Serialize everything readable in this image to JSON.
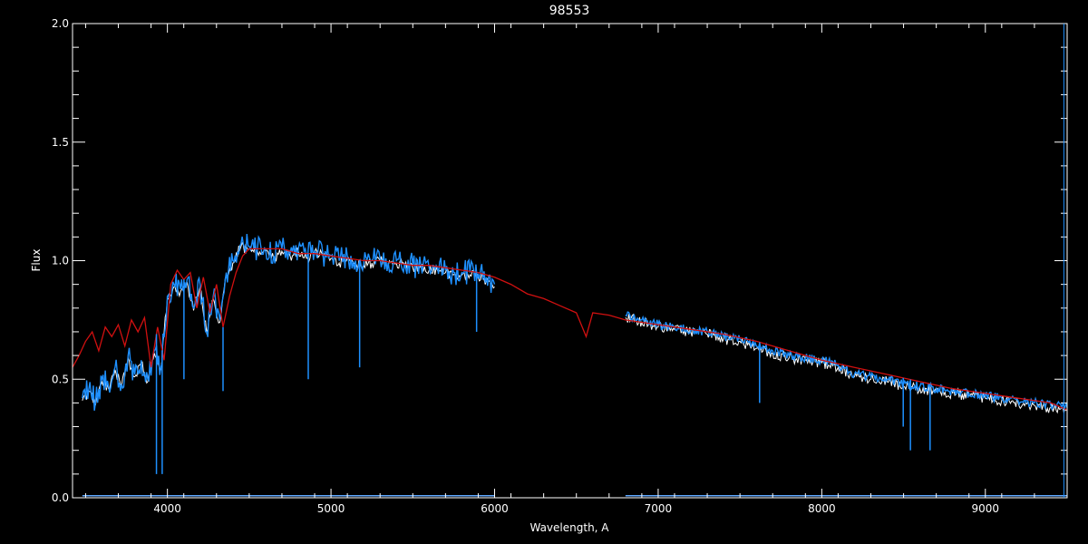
{
  "chart_data": {
    "type": "line",
    "title": "98553",
    "xlabel": "Wavelength, A",
    "ylabel": "Flux",
    "xlim": [
      3420,
      9500
    ],
    "ylim": [
      0.0,
      2.0
    ],
    "x_ticks": [
      4000,
      5000,
      6000,
      7000,
      8000,
      9000
    ],
    "x_tick_labels": [
      "4000",
      "5000",
      "6000",
      "7000",
      "8000",
      "9000"
    ],
    "y_ticks": [
      0.0,
      0.5,
      1.0,
      1.5,
      2.0
    ],
    "y_tick_labels": [
      "0.0",
      "0.5",
      "1.0",
      "1.5",
      "2.0"
    ],
    "grid": false,
    "colors": {
      "background": "#000000",
      "axes": "#ffffff",
      "observed": "#1e90ff",
      "observed_white": "#ffffff",
      "model": "#d01010",
      "error": "#5fa8ff"
    },
    "series": [
      {
        "role": "observed-segment-1",
        "color": "#1e90ff",
        "x": [
          3480,
          3520,
          3560,
          3600,
          3640,
          3680,
          3720,
          3760,
          3800,
          3840,
          3880,
          3920,
          3960,
          4000,
          4040,
          4080,
          4120,
          4160,
          4200,
          4240,
          4280,
          4320,
          4360,
          4400,
          4450,
          4500,
          4550,
          4600,
          4650,
          4700,
          4750,
          4800,
          4850,
          4900,
          4950,
          5000,
          5050,
          5100,
          5150,
          5200,
          5250,
          5300,
          5350,
          5400,
          5450,
          5500,
          5550,
          5600,
          5650,
          5700,
          5750,
          5800,
          5850,
          5900,
          5950,
          6000
        ],
        "y": [
          0.42,
          0.46,
          0.4,
          0.5,
          0.47,
          0.55,
          0.48,
          0.6,
          0.52,
          0.58,
          0.5,
          0.62,
          0.55,
          0.85,
          0.9,
          0.88,
          0.92,
          0.8,
          0.9,
          0.7,
          0.85,
          0.75,
          0.95,
          1.0,
          1.07,
          1.06,
          1.05,
          1.05,
          1.02,
          1.05,
          1.03,
          1.05,
          1.02,
          1.04,
          1.03,
          1.02,
          1.0,
          1.02,
          1.0,
          0.99,
          1.0,
          1.01,
          0.99,
          1.0,
          0.99,
          0.98,
          0.98,
          0.97,
          0.97,
          0.96,
          0.95,
          0.95,
          0.95,
          0.94,
          0.93,
          0.9
        ]
      },
      {
        "role": "observed-segment-2",
        "color": "#1e90ff",
        "x": [
          6800,
          6900,
          7000,
          7100,
          7200,
          7300,
          7400,
          7500,
          7600,
          7700,
          7800,
          7900,
          8000,
          8100,
          8200,
          8300,
          8400,
          8500,
          8600,
          8700,
          8800,
          8900,
          9000,
          9100,
          9200,
          9300,
          9400,
          9500
        ],
        "y": [
          0.77,
          0.75,
          0.73,
          0.72,
          0.71,
          0.7,
          0.68,
          0.67,
          0.64,
          0.62,
          0.6,
          0.59,
          0.58,
          0.56,
          0.52,
          0.51,
          0.5,
          0.48,
          0.47,
          0.46,
          0.45,
          0.44,
          0.43,
          0.42,
          0.41,
          0.4,
          0.39,
          0.38
        ]
      },
      {
        "role": "model",
        "color": "#d01010",
        "x": [
          3420,
          3460,
          3500,
          3540,
          3580,
          3620,
          3660,
          3700,
          3740,
          3780,
          3820,
          3860,
          3900,
          3940,
          3980,
          4020,
          4060,
          4100,
          4140,
          4180,
          4220,
          4260,
          4300,
          4340,
          4380,
          4420,
          4460,
          4500,
          4600,
          4700,
          4800,
          4900,
          5000,
          5100,
          5200,
          5300,
          5400,
          5500,
          5600,
          5700,
          5800,
          5900,
          6000,
          6100,
          6200,
          6300,
          6400,
          6500,
          6560,
          6600,
          6700,
          6800,
          7000,
          7200,
          7400,
          7600,
          7800,
          8000,
          8200,
          8400,
          8600,
          8800,
          9000,
          9200,
          9400,
          9500
        ],
        "y": [
          0.55,
          0.6,
          0.66,
          0.7,
          0.62,
          0.72,
          0.68,
          0.73,
          0.64,
          0.75,
          0.7,
          0.76,
          0.55,
          0.72,
          0.58,
          0.9,
          0.96,
          0.92,
          0.95,
          0.8,
          0.93,
          0.78,
          0.9,
          0.72,
          0.85,
          0.95,
          1.02,
          1.05,
          1.05,
          1.05,
          1.03,
          1.03,
          1.02,
          1.01,
          1.0,
          1.0,
          0.99,
          0.98,
          0.98,
          0.97,
          0.96,
          0.95,
          0.93,
          0.9,
          0.86,
          0.84,
          0.81,
          0.78,
          0.68,
          0.78,
          0.77,
          0.75,
          0.73,
          0.71,
          0.69,
          0.66,
          0.62,
          0.58,
          0.55,
          0.52,
          0.49,
          0.46,
          0.44,
          0.42,
          0.4,
          0.37
        ]
      },
      {
        "role": "error",
        "color": "#5fa8ff",
        "x": [
          3480,
          6000,
          6800,
          9500
        ],
        "y": [
          0.005,
          0.005,
          0.005,
          0.005
        ]
      }
    ],
    "absorption_lines": [
      {
        "x": 3933,
        "y": 0.1
      },
      {
        "x": 3968,
        "y": 0.1
      },
      {
        "x": 4101,
        "y": 0.5
      },
      {
        "x": 4340,
        "y": 0.45
      },
      {
        "x": 4861,
        "y": 0.5
      },
      {
        "x": 5175,
        "y": 0.55
      },
      {
        "x": 5890,
        "y": 0.7
      },
      {
        "x": 7620,
        "y": 0.4
      },
      {
        "x": 8498,
        "y": 0.3
      },
      {
        "x": 8542,
        "y": 0.2
      },
      {
        "x": 8662,
        "y": 0.2
      }
    ]
  }
}
